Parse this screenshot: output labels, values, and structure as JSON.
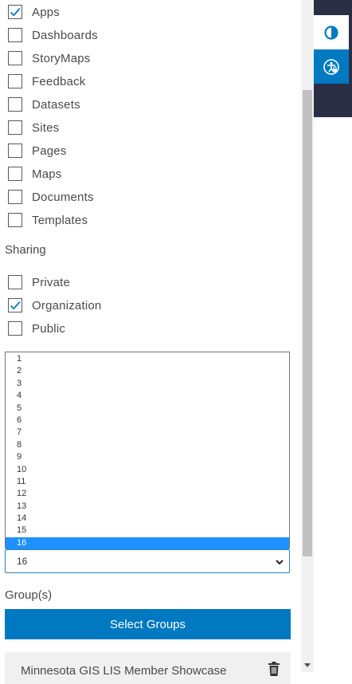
{
  "item_types": [
    {
      "label": "Apps",
      "checked": true
    },
    {
      "label": "Dashboards",
      "checked": false
    },
    {
      "label": "StoryMaps",
      "checked": false
    },
    {
      "label": "Feedback",
      "checked": false
    },
    {
      "label": "Datasets",
      "checked": false
    },
    {
      "label": "Sites",
      "checked": false
    },
    {
      "label": "Pages",
      "checked": false
    },
    {
      "label": "Maps",
      "checked": false
    },
    {
      "label": "Documents",
      "checked": false
    },
    {
      "label": "Templates",
      "checked": false
    }
  ],
  "sharing": {
    "title": "Sharing",
    "options": [
      {
        "label": "Private",
        "checked": false
      },
      {
        "label": "Organization",
        "checked": true
      },
      {
        "label": "Public",
        "checked": false
      }
    ]
  },
  "number_select": {
    "options": [
      "1",
      "2",
      "3",
      "4",
      "5",
      "6",
      "7",
      "8",
      "9",
      "10",
      "11",
      "12",
      "13",
      "14",
      "15",
      "16"
    ],
    "selected": "16"
  },
  "groups": {
    "title": "Group(s)",
    "select_button": "Select Groups",
    "items": [
      {
        "label": "Minnesota GIS LIS Member Showcase"
      }
    ]
  },
  "side_tools": {
    "contrast_icon": "contrast-icon",
    "accessibility_icon": "accessibility-icon"
  },
  "colors": {
    "accent": "#0079c1",
    "highlight": "#1e90ff",
    "dark_bar": "#2b2f45"
  }
}
